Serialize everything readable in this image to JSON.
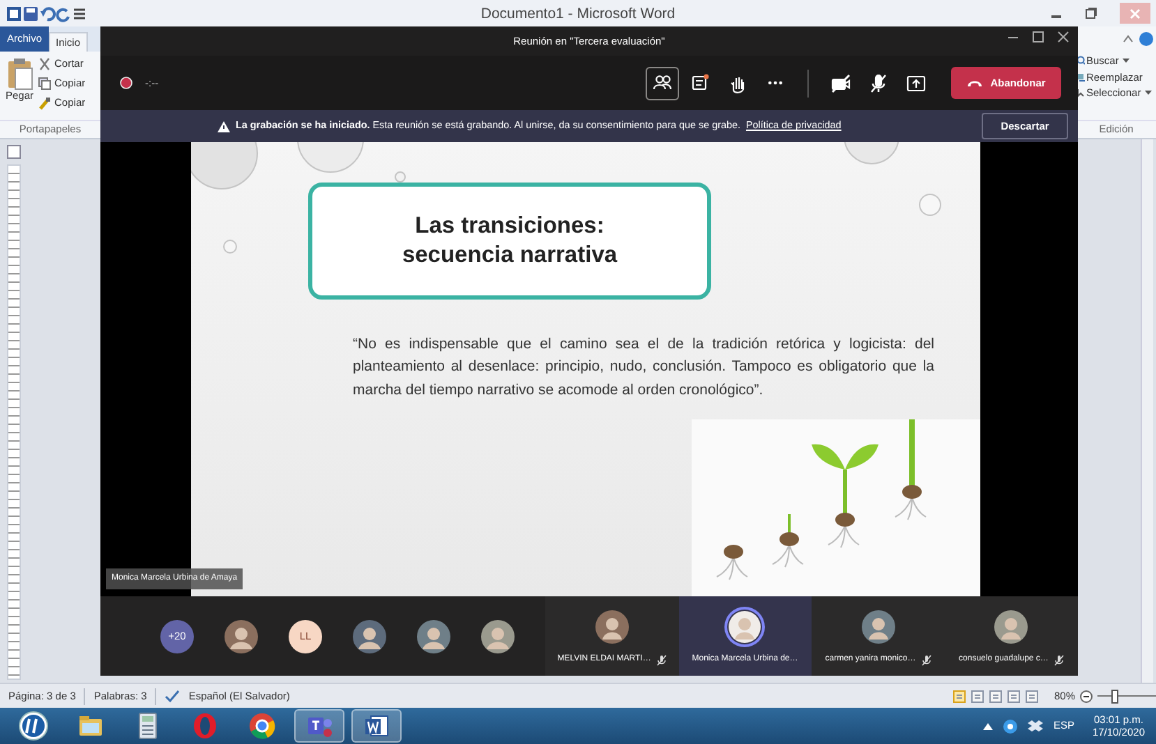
{
  "word": {
    "title": "Documento1 - Microsoft Word",
    "tabs": [
      {
        "label": "Archivo",
        "kind": "file",
        "selected": false
      },
      {
        "label": "Inicio",
        "kind": "tab",
        "selected": true
      }
    ],
    "clipboard": {
      "paste": "Pegar",
      "items": [
        {
          "label": "Cortar",
          "kind": "cut"
        },
        {
          "label": "Copiar",
          "kind": "copy"
        },
        {
          "label": "Copiar",
          "kind": "brush"
        }
      ],
      "group": "Portapapeles"
    },
    "editing": {
      "items": [
        {
          "label": "Buscar",
          "kind": "find",
          "dropdown": true
        },
        {
          "label": "Reemplazar",
          "kind": "replace",
          "dropdown": false
        },
        {
          "label": "Seleccionar",
          "kind": "select",
          "dropdown": true
        }
      ],
      "group": "Edición"
    },
    "status_bar": {
      "items": [
        "Página: 3 de 3",
        "Palabras: 3",
        "Español (El Salvador)"
      ],
      "zoom": "80%",
      "zoom_slider": {
        "level": 0.27
      }
    }
  },
  "teams": {
    "title": "Reunión en \"Tercera evaluación\"",
    "timer": "-:--",
    "toolbar": [
      {
        "kind": "participants",
        "selected": true
      },
      {
        "kind": "chat",
        "selected": false
      },
      {
        "kind": "hand",
        "selected": false
      },
      {
        "kind": "more",
        "selected": false
      },
      {
        "kind": "camera-off",
        "selected": false
      },
      {
        "kind": "mic-off",
        "selected": false
      },
      {
        "kind": "share",
        "selected": false
      }
    ],
    "leave": "Abandonar",
    "banner": {
      "notice": "**La grabación se ha iniciado.** Esta reunión se está grabando. Al unirse, da su consentimiento para que se grabe.",
      "link": "Política de privacidad",
      "dismiss": "Descartar"
    },
    "slide": {
      "title_lines": [
        "Las transiciones:",
        "secuencia narrativa"
      ],
      "quote": "“No es indispensable que el camino sea el de la tradición retórica y logicista: del planteamiento al desenlace: principio, nudo, conclusión. Tampoco es obligatorio que la marcha del tiempo narrativo se acomode al orden cronológico”."
    },
    "speaker": "Monica Marcela Urbina de Amaya",
    "participants": [
      {
        "kind": "overflow",
        "label": "+20"
      },
      {
        "kind": "photo"
      },
      {
        "kind": "initials",
        "label": "LL"
      },
      {
        "kind": "photo"
      },
      {
        "kind": "photo"
      },
      {
        "kind": "photo"
      },
      {
        "kind": "tile",
        "name": "MELVIN ELDAI MARTI…",
        "muted": true,
        "selected": false
      },
      {
        "kind": "tile",
        "name": "Monica Marcela Urbina de…",
        "muted": false,
        "selected": true
      },
      {
        "kind": "tile",
        "name": "carmen yanira monico…",
        "muted": true,
        "selected": false
      },
      {
        "kind": "tile",
        "name": "consuelo guadalupe c…",
        "muted": true,
        "selected": false
      }
    ]
  },
  "taskbar": {
    "apps": [
      {
        "kind": "folder",
        "selected": false
      },
      {
        "kind": "calculator",
        "selected": false
      },
      {
        "kind": "opera",
        "selected": false
      },
      {
        "kind": "chrome",
        "selected": false
      },
      {
        "kind": "teams",
        "selected": true
      },
      {
        "kind": "word",
        "selected": true
      }
    ],
    "language": "ESP",
    "time": "03:01 p.m.",
    "date": "17/10/2020"
  }
}
